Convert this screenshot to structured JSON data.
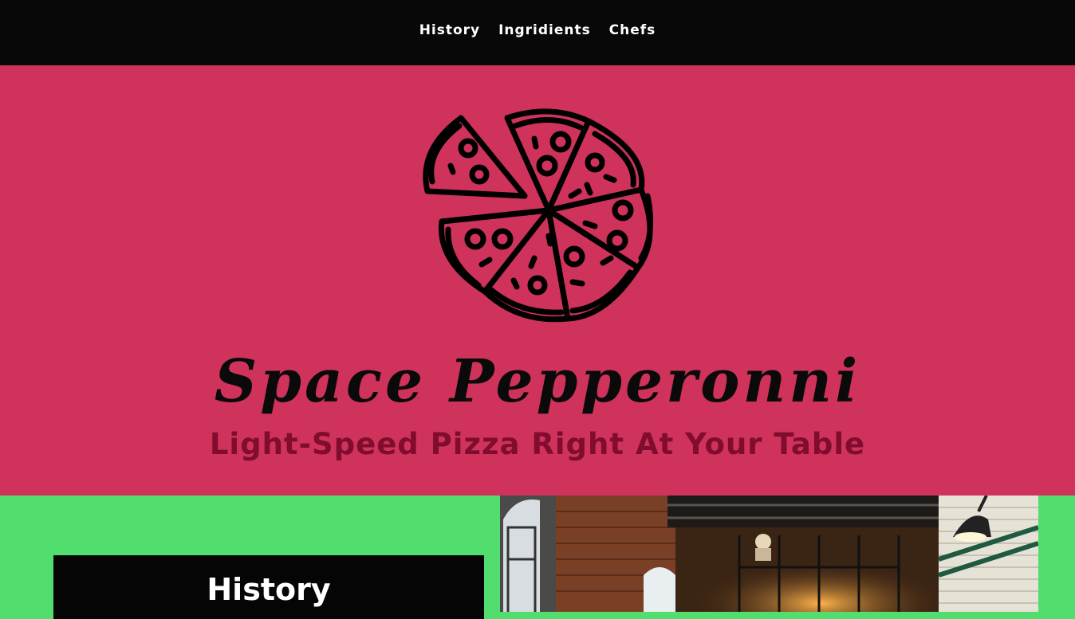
{
  "nav": {
    "items": [
      {
        "label": "History"
      },
      {
        "label": "Ingridients"
      },
      {
        "label": "Chefs"
      }
    ]
  },
  "hero": {
    "logo_icon": "pizza-icon",
    "title": "Space Pepperonni",
    "tagline": "Light-Speed Pizza Right At Your Table"
  },
  "history": {
    "heading": "History",
    "photo_icon": "restaurant-interior-photo"
  },
  "colors": {
    "nav_bg": "#080808",
    "hero_bg": "#cf325a",
    "section_bg": "#52de6f",
    "tagline": "#800c2e"
  }
}
